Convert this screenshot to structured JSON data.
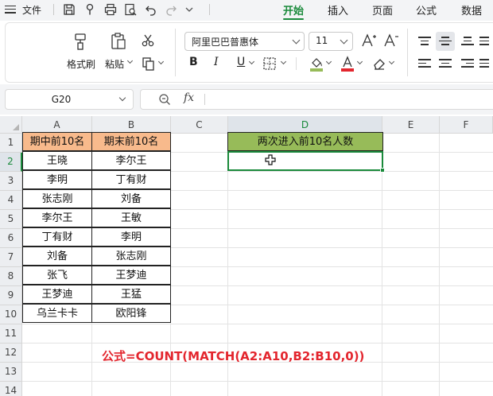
{
  "menu": {
    "file_label": "文件",
    "tabs": [
      {
        "label": "开始",
        "active": true
      },
      {
        "label": "插入",
        "active": false
      },
      {
        "label": "页面",
        "active": false
      },
      {
        "label": "公式",
        "active": false
      },
      {
        "label": "数据",
        "active": false
      }
    ]
  },
  "ribbon": {
    "format_painter": "格式刷",
    "paste": "粘贴",
    "font_name": "阿里巴巴普惠体",
    "font_size": "11",
    "bold": "B",
    "italic": "I",
    "underline": "U",
    "font_color": "#e3262e",
    "fill_color": "#97bb59"
  },
  "formula_bar": {
    "name_box": "G20",
    "fx_label": "fx",
    "formula": ""
  },
  "sheet": {
    "columns": [
      "A",
      "B",
      "C",
      "D",
      "E",
      "F"
    ],
    "rows": [
      "1",
      "2",
      "3",
      "4",
      "5",
      "6",
      "7",
      "8",
      "9",
      "10",
      "11",
      "12",
      "13",
      "14"
    ],
    "selected_column": "D",
    "selected_row": "2",
    "a_header": "期中前10名",
    "b_header": "期末前10名",
    "d_header": "两次进入前10名人数",
    "col_a": [
      "王晓",
      "李明",
      "张志刚",
      "李尔王",
      "丁有财",
      "刘备",
      "张飞",
      "王梦迪",
      "乌兰卡卡"
    ],
    "col_b": [
      "李尔王",
      "丁有财",
      "刘备",
      "王敏",
      "李明",
      "张志刚",
      "王梦迪",
      "王猛",
      "欧阳锋"
    ],
    "d2_value": "",
    "header_fill": "#f8ba8c",
    "d_header_fill": "#97bb59",
    "accent": "#1a8a3b"
  },
  "annotation": "公式=COUNT(MATCH(A2:A10,B2:B10,0))"
}
